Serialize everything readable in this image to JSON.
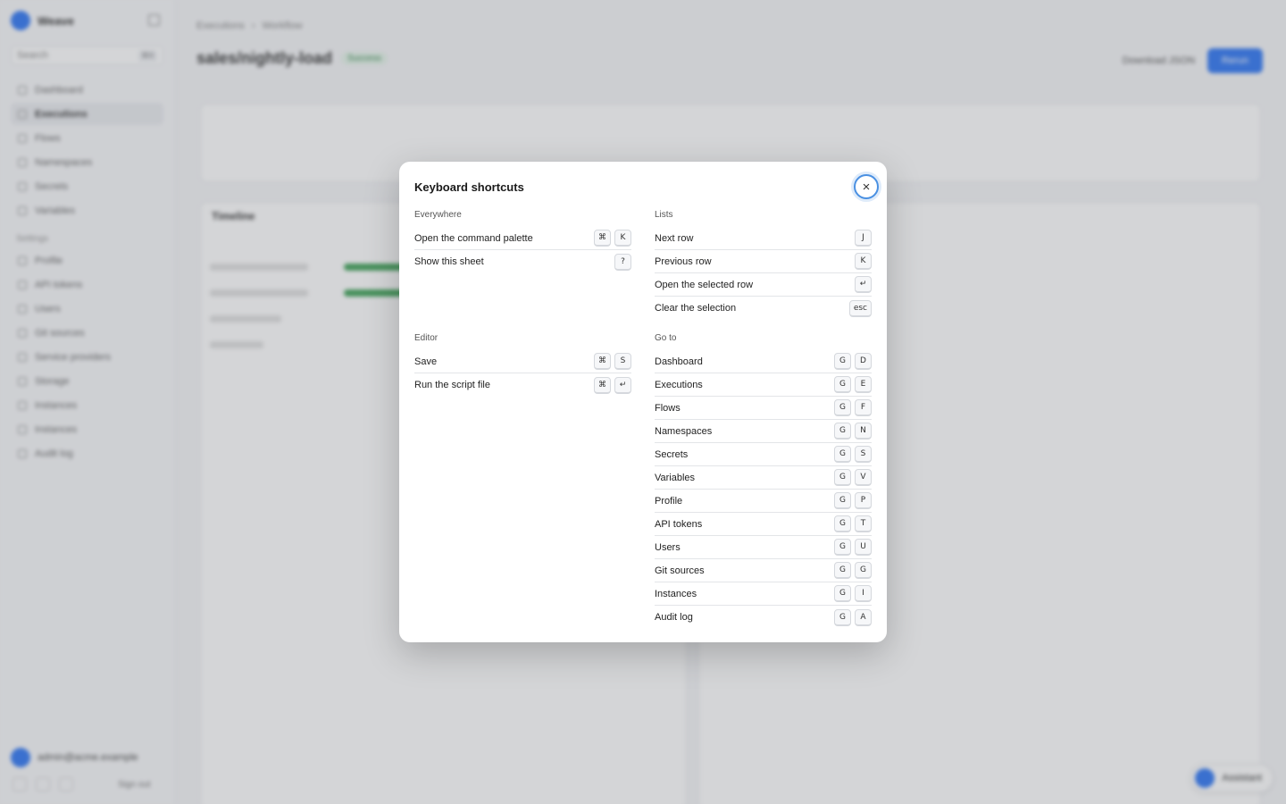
{
  "modal": {
    "title": "Keyboard shortcuts",
    "close_icon": "×",
    "groups": [
      {
        "title": "Everywhere",
        "items": [
          {
            "label": "Open the command palette",
            "keys": [
              "⌘",
              "K"
            ]
          },
          {
            "label": "Show this sheet",
            "keys": [
              "?"
            ]
          }
        ]
      },
      {
        "title": "Editor",
        "items": [
          {
            "label": "Save",
            "keys": [
              "⌘",
              "S"
            ]
          },
          {
            "label": "Run the script file",
            "keys": [
              "⌘",
              "↵"
            ]
          }
        ]
      },
      {
        "title": "Lists",
        "items": [
          {
            "label": "Next row",
            "keys": [
              "J"
            ]
          },
          {
            "label": "Previous row",
            "keys": [
              "K"
            ]
          },
          {
            "label": "Open the selected row",
            "keys": [
              "↵"
            ]
          },
          {
            "label": "Clear the selection",
            "keys": [
              "esc"
            ]
          }
        ]
      },
      {
        "title": "Go to",
        "items": [
          {
            "label": "Dashboard",
            "keys": [
              "G",
              "D"
            ]
          },
          {
            "label": "Executions",
            "keys": [
              "G",
              "E"
            ]
          },
          {
            "label": "Flows",
            "keys": [
              "G",
              "F"
            ]
          },
          {
            "label": "Namespaces",
            "keys": [
              "G",
              "N"
            ]
          },
          {
            "label": "Secrets",
            "keys": [
              "G",
              "S"
            ]
          },
          {
            "label": "Variables",
            "keys": [
              "G",
              "V"
            ]
          },
          {
            "label": "Profile",
            "keys": [
              "G",
              "P"
            ]
          },
          {
            "label": "API tokens",
            "keys": [
              "G",
              "T"
            ]
          },
          {
            "label": "Users",
            "keys": [
              "G",
              "U"
            ]
          },
          {
            "label": "Git sources",
            "keys": [
              "G",
              "G"
            ]
          },
          {
            "label": "Instances",
            "keys": [
              "G",
              "I"
            ]
          },
          {
            "label": "Audit log",
            "keys": [
              "G",
              "A"
            ]
          }
        ]
      }
    ]
  },
  "background": {
    "brand": "Weave",
    "search_placeholder": "Search",
    "search_kbd": "⌘K",
    "nav": [
      "Dashboard",
      "Executions",
      "Flows",
      "Namespaces",
      "Secrets",
      "Variables"
    ],
    "settings_section": "Settings",
    "settings_nav": [
      "Profile",
      "API tokens",
      "Users",
      "Git sources",
      "Service providers",
      "Storage",
      "Instances",
      "Instances",
      "Audit log"
    ],
    "user_email": "admin@acme.example",
    "sign_out": "Sign out",
    "breadcrumb": [
      "Executions",
      "Workflow"
    ],
    "page_title": "sales/nightly-load",
    "status": "Success",
    "download_json": "Download JSON",
    "rerun": "Rerun",
    "timeline_title": "Timeline",
    "assistant": "Assistant"
  }
}
